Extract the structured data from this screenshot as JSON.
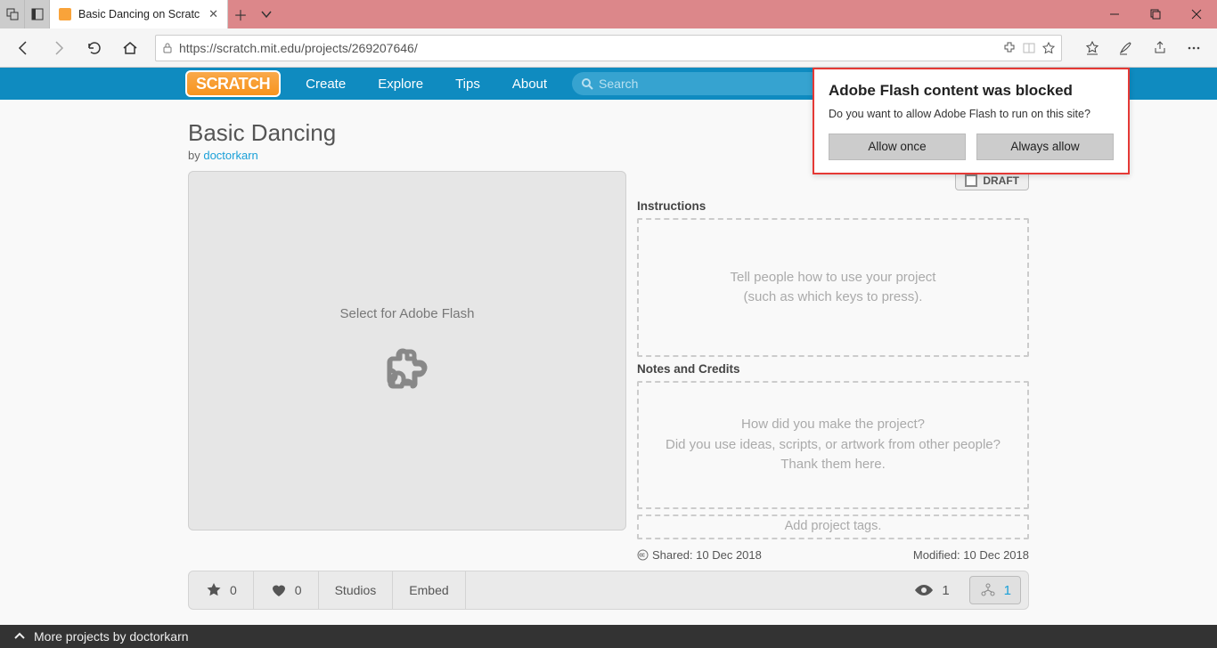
{
  "browser": {
    "tab_title": "Basic Dancing on Scratc",
    "url": "https://scratch.mit.edu/projects/269207646/"
  },
  "nav": {
    "logo": "SCRATCH",
    "items": [
      "Create",
      "Explore",
      "Tips",
      "About"
    ],
    "search_placeholder": "Search"
  },
  "project": {
    "title": "Basic Dancing",
    "by_prefix": "by ",
    "author": "doctorkarn",
    "flash_select": "Select for Adobe Flash",
    "draft_label": "DRAFT",
    "instructions_label": "Instructions",
    "instructions_placeholder": "Tell people how to use your project\n(such as which keys to press).",
    "notes_label": "Notes and Credits",
    "notes_placeholder": "How did you make the project?\nDid you use ideas, scripts, or artwork from other people? Thank them here.",
    "tags_placeholder": "Add project tags.",
    "shared": "Shared: 10 Dec 2018",
    "modified": "Modified: 10 Dec 2018"
  },
  "stats": {
    "stars": "0",
    "loves": "0",
    "studios": "Studios",
    "embed": "Embed",
    "views": "1",
    "remix": "1"
  },
  "bottom": {
    "more": "More projects by doctorkarn"
  },
  "popup": {
    "title": "Adobe Flash content was blocked",
    "body": "Do you want to allow Adobe Flash to run on this site?",
    "allow_once": "Allow once",
    "always_allow": "Always allow"
  }
}
